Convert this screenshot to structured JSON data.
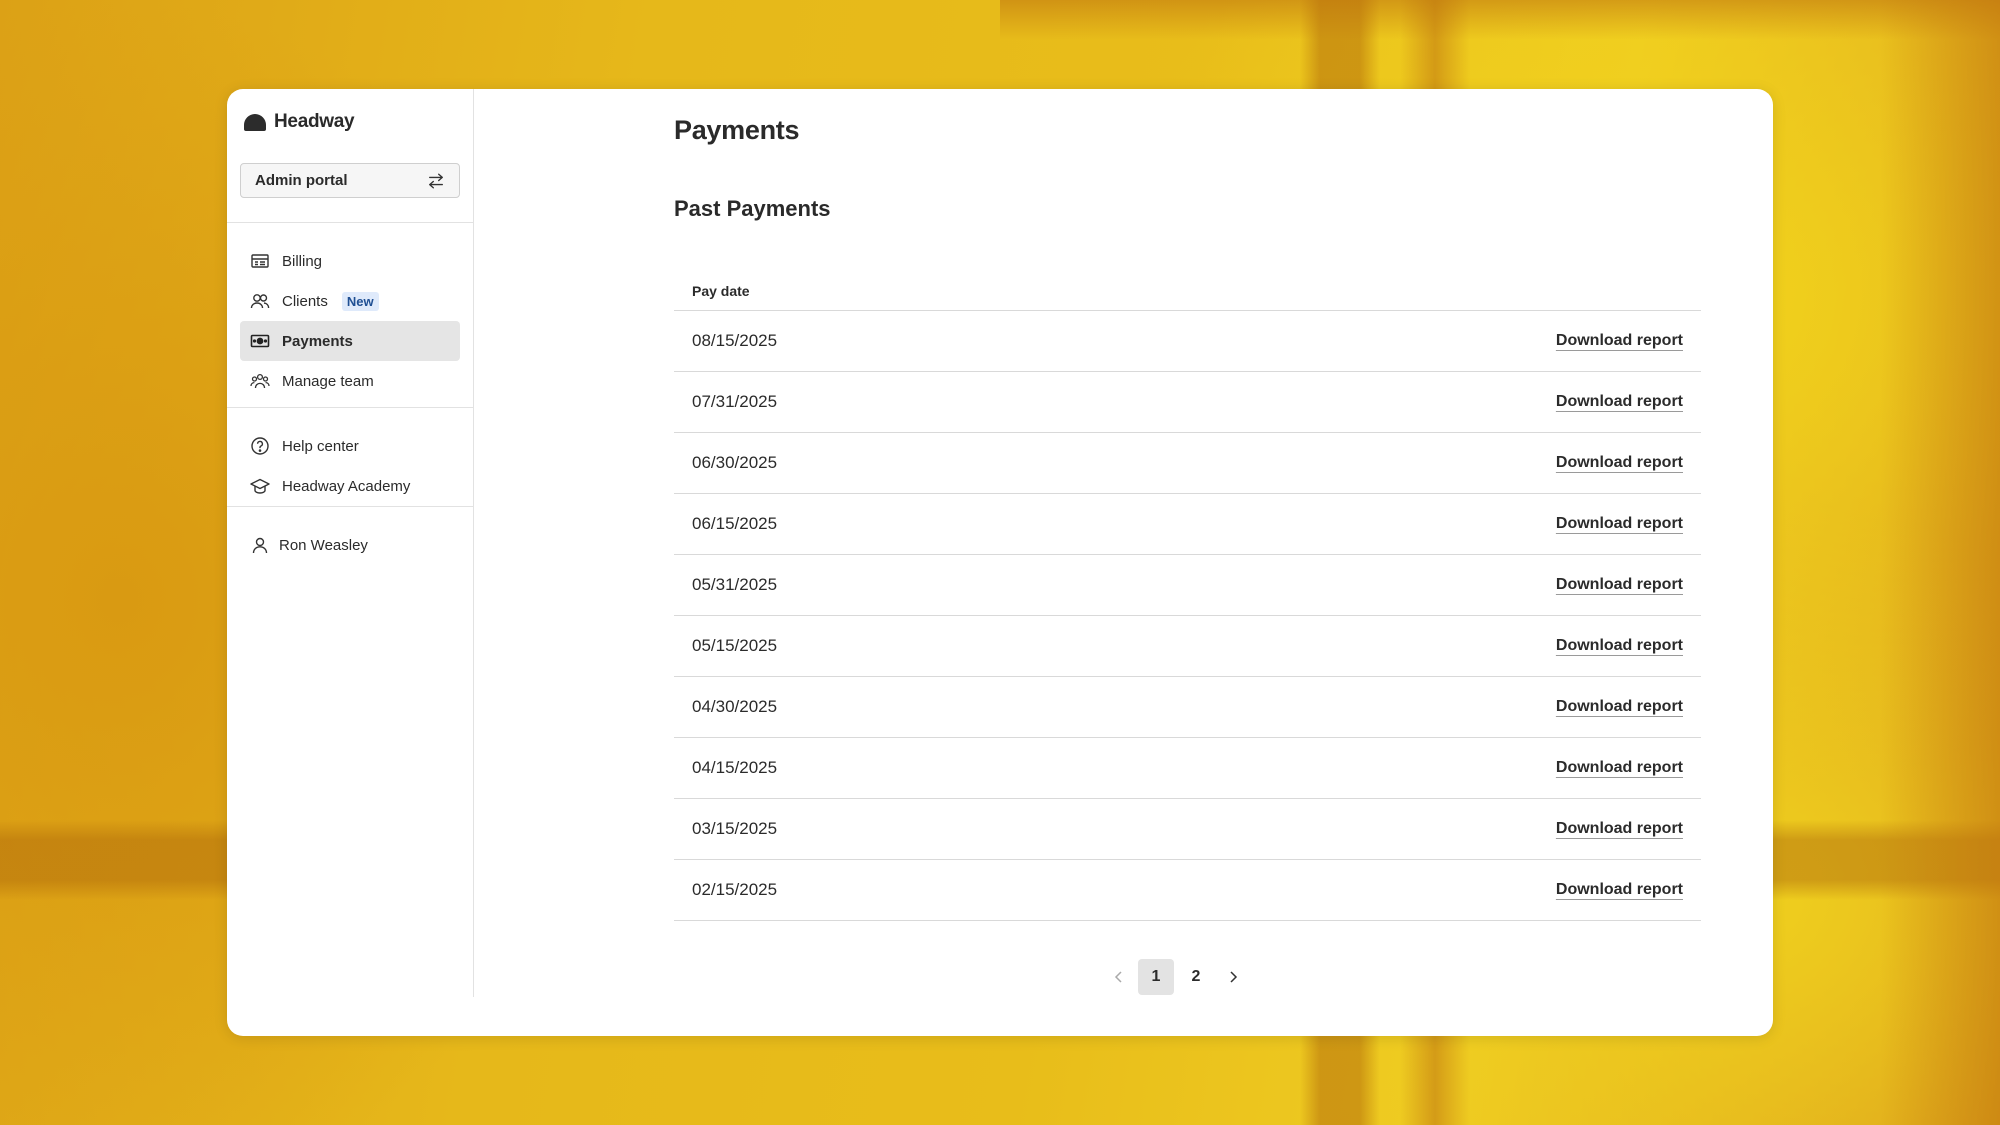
{
  "brand": {
    "name": "Headway"
  },
  "portal": {
    "label": "Admin portal",
    "icon": "switch-arrows-icon"
  },
  "nav": {
    "primary": [
      {
        "label": "Billing",
        "icon": "billing-icon"
      },
      {
        "label": "Clients",
        "icon": "clients-icon",
        "badge": "New"
      },
      {
        "label": "Payments",
        "icon": "payments-icon",
        "active": true
      },
      {
        "label": "Manage team",
        "icon": "team-icon"
      }
    ],
    "secondary": [
      {
        "label": "Help center",
        "icon": "help-icon"
      },
      {
        "label": "Headway Academy",
        "icon": "academy-icon"
      }
    ],
    "user": {
      "label": "Ron Weasley",
      "icon": "user-icon"
    }
  },
  "page": {
    "title": "Payments",
    "section_title": "Past Payments"
  },
  "table": {
    "header": "Pay date",
    "action_label": "Download report",
    "rows": [
      "08/15/2025",
      "07/31/2025",
      "06/30/2025",
      "06/15/2025",
      "05/31/2025",
      "05/15/2025",
      "04/30/2025",
      "04/15/2025",
      "03/15/2025",
      "02/15/2025"
    ]
  },
  "pagination": {
    "pages": [
      "1",
      "2"
    ],
    "current": "1"
  }
}
